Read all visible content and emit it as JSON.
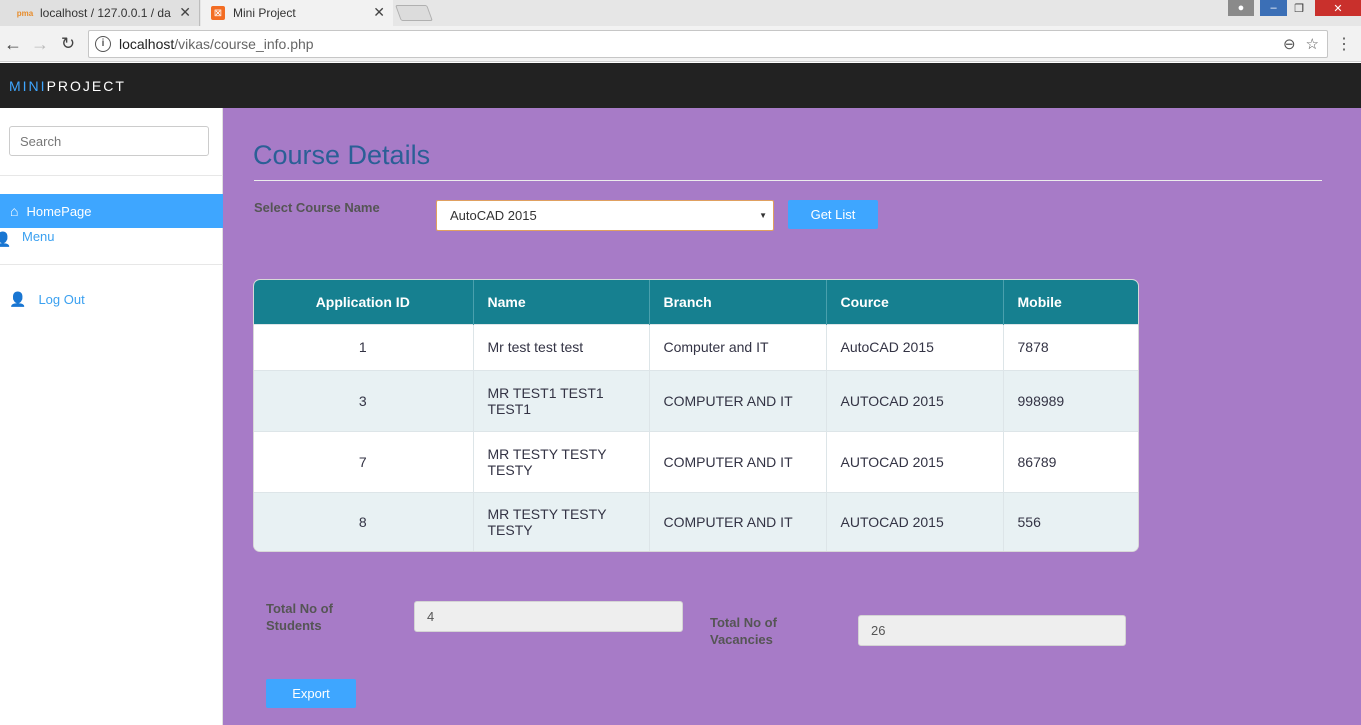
{
  "browser": {
    "tabs": [
      {
        "title": "localhost / 127.0.0.1 / da",
        "favicon": "phpmyadmin-icon",
        "active": false
      },
      {
        "title": "Mini Project",
        "favicon": "xampp-icon",
        "active": true
      }
    ],
    "address": {
      "host": "localhost",
      "path": "/vikas/course_info.php"
    }
  },
  "app": {
    "brand_a": "MINI",
    "brand_b": "PROJECT"
  },
  "sidebar": {
    "search_placeholder": "Search",
    "items": [
      {
        "label": "HomePage",
        "icon": "home-icon",
        "active": true
      },
      {
        "label": "Menu",
        "icon": "user-icon",
        "active": false
      },
      {
        "label": "Log Out",
        "icon": "user-icon",
        "active": false
      }
    ]
  },
  "main": {
    "title": "Course Details",
    "select_label": "Select Course Name",
    "selected_course": "AutoCAD 2015",
    "get_list_label": "Get List",
    "table": {
      "headers": [
        "Application ID",
        "Name",
        "Branch",
        "Cource",
        "Mobile"
      ],
      "rows": [
        [
          "1",
          "Mr test test test",
          "Computer and IT",
          "AutoCAD 2015",
          "7878"
        ],
        [
          "3",
          "MR TEST1 TEST1 TEST1",
          "COMPUTER AND IT",
          "AUTOCAD 2015",
          "998989"
        ],
        [
          "7",
          "MR TESTY TESTY TESTY",
          "COMPUTER AND IT",
          "AUTOCAD 2015",
          "86789"
        ],
        [
          "8",
          "MR TESTY TESTY TESTY",
          "COMPUTER AND IT",
          "AUTOCAD 2015",
          "556"
        ]
      ]
    },
    "total_students_label": "Total No of Students",
    "total_students_value": "4",
    "total_vacancies_label": "Total No of Vacancies",
    "total_vacancies_value": "26",
    "export_label": "Export"
  },
  "colors": {
    "accent": "#3ea6ff",
    "main_bg": "#a77bc7",
    "table_header": "#168090",
    "header_bar": "#222222"
  }
}
